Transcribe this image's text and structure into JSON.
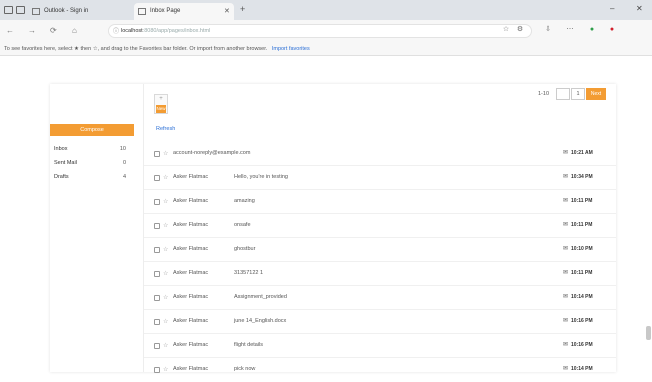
{
  "browser": {
    "tabs": [
      {
        "label": "Outlook - Sign in",
        "active": false
      },
      {
        "label": "Inbox Page",
        "active": true
      }
    ],
    "url_host": "localhost",
    "url_rest": ":8080/app/pages/inbox.html",
    "new_tab": "+",
    "win_min": "–",
    "win_close": "✕",
    "back": "←",
    "forward": "→",
    "refresh": "⟳",
    "home": "⌂",
    "lock": "ⓘ",
    "tools": [
      "☆",
      "⚙",
      "⇩",
      "⋯",
      "●",
      "●"
    ],
    "tool_colors": [
      "#666666",
      "#666666",
      "#666666",
      "#666666",
      "#2e9e4a",
      "#d21f2b"
    ],
    "favorites_prompt": "To see favorites here, select ★ then ☆, and drag to the Favorites bar folder. Or import from another browser.",
    "favorites_link": "Import favorites"
  },
  "app": {
    "compose_label": "Compose",
    "folders": [
      {
        "name": "Inbox",
        "count": "10"
      },
      {
        "name": "Sent Mail",
        "count": "0"
      },
      {
        "name": "Drafts",
        "count": "4"
      }
    ],
    "new_button": {
      "icon": "+",
      "label": "New"
    },
    "refresh_link": "Refresh",
    "pager": {
      "range": "1-10",
      "page": "1",
      "next_label": "Next"
    },
    "accent": "#f39c33",
    "messages": [
      {
        "from": "account-noreply@example.com",
        "subject": "Welcome to Inbox",
        "time": "10:21 AM"
      },
      {
        "from": "Asker Flatmac",
        "subject": "Hello, you're in testing",
        "time": "10:34 PM"
      },
      {
        "from": "Asker Flatmac",
        "subject": "amazing",
        "time": "10:11 PM"
      },
      {
        "from": "Asker Flatmac",
        "subject": "onsafe",
        "time": "10:11 PM"
      },
      {
        "from": "Asker Flatmac",
        "subject": "ghostbur",
        "time": "10:10 PM"
      },
      {
        "from": "Asker Flatmac",
        "subject": "31357122 1",
        "time": "10:11 PM"
      },
      {
        "from": "Asker Flatmac",
        "subject": "Assignment_provided",
        "time": "10:14 PM"
      },
      {
        "from": "Asker Flatmac",
        "subject": "june 14_English.docx",
        "time": "10:16 PM"
      },
      {
        "from": "Asker Flatmac",
        "subject": "flight details",
        "time": "10:16 PM"
      },
      {
        "from": "Asker Flatmac",
        "subject": "pick now",
        "time": "10:14 PM"
      }
    ]
  }
}
